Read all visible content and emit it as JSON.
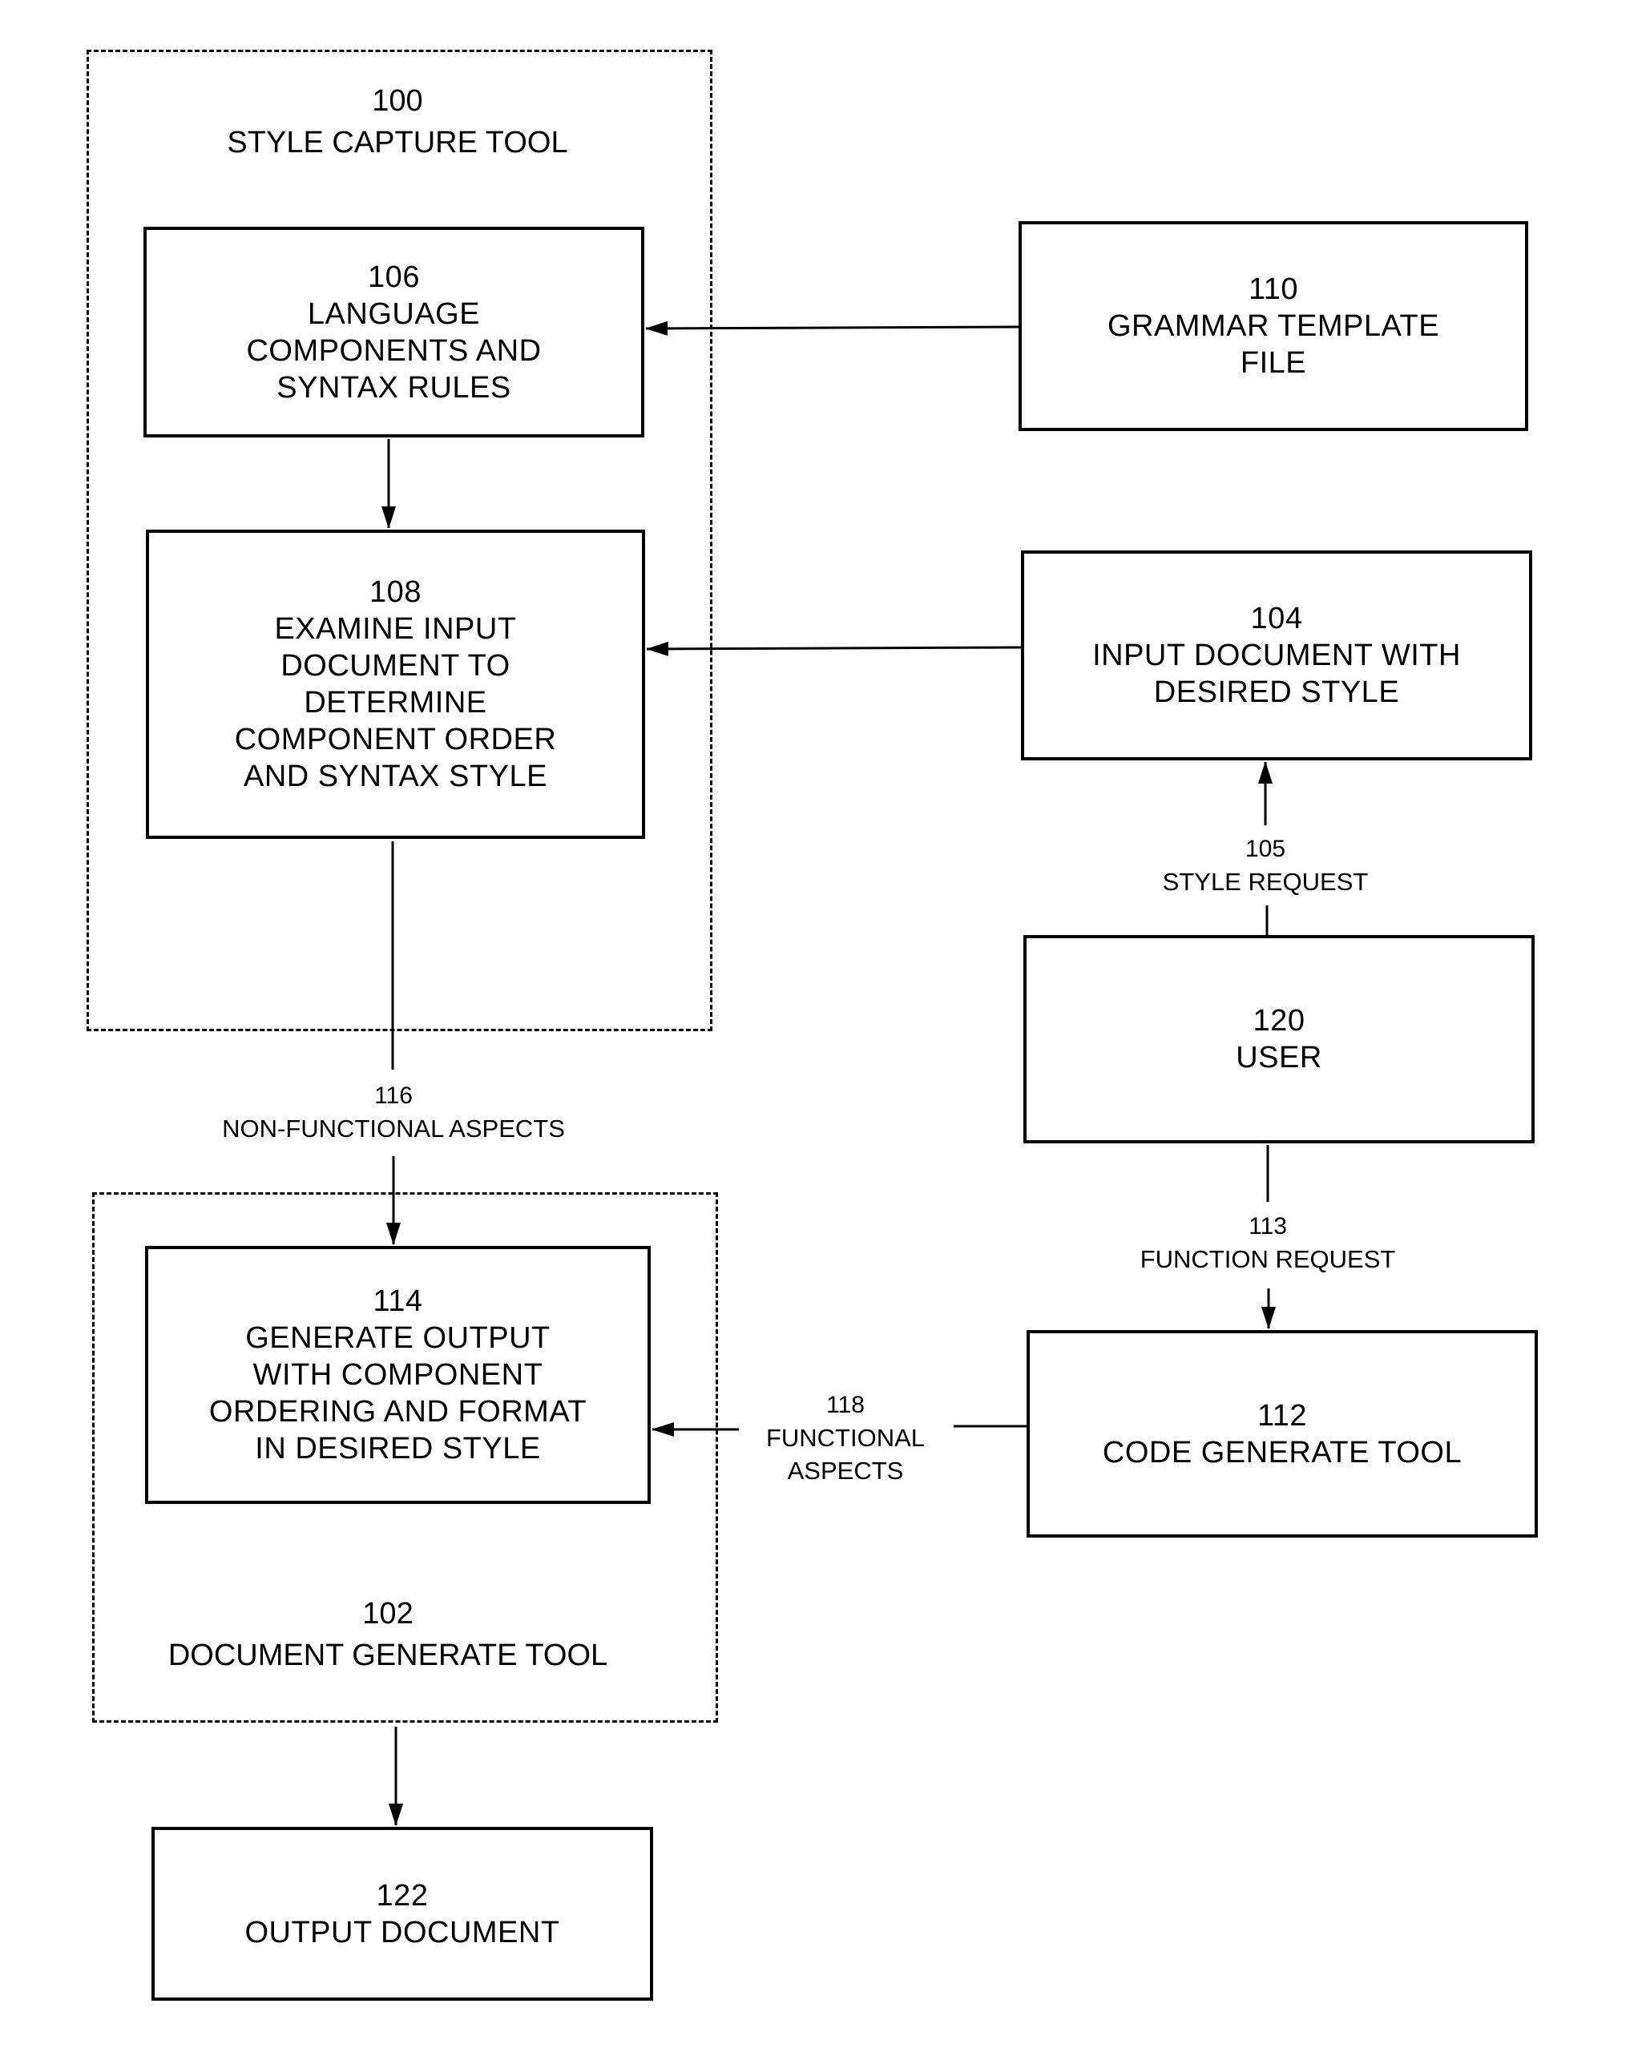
{
  "groups": {
    "style_capture": {
      "number": "100",
      "label": "STYLE CAPTURE TOOL"
    },
    "document_generate": {
      "number": "102",
      "label": "DOCUMENT GENERATE TOOL"
    }
  },
  "boxes": {
    "b106": {
      "number": "106",
      "label": "LANGUAGE\nCOMPONENTS AND\nSYNTAX RULES"
    },
    "b108": {
      "number": "108",
      "label": "EXAMINE INPUT\nDOCUMENT TO\nDETERMINE\nCOMPONENT ORDER\nAND SYNTAX STYLE"
    },
    "b110": {
      "number": "110",
      "label": "GRAMMAR TEMPLATE\nFILE"
    },
    "b104": {
      "number": "104",
      "label": "INPUT DOCUMENT WITH\nDESIRED STYLE"
    },
    "b120": {
      "number": "120",
      "label": "USER"
    },
    "b112": {
      "number": "112",
      "label": "CODE GENERATE TOOL"
    },
    "b114": {
      "number": "114",
      "label": "GENERATE OUTPUT\nWITH COMPONENT\nORDERING AND FORMAT\nIN DESIRED STYLE"
    },
    "b122": {
      "number": "122",
      "label": "OUTPUT DOCUMENT"
    }
  },
  "edges": {
    "e105": {
      "number": "105",
      "label": "STYLE REQUEST"
    },
    "e113": {
      "number": "113",
      "label": "FUNCTION REQUEST"
    },
    "e116": {
      "number": "116",
      "label": "NON-FUNCTIONAL ASPECTS"
    },
    "e118": {
      "number": "118",
      "label": "FUNCTIONAL\nASPECTS"
    }
  }
}
